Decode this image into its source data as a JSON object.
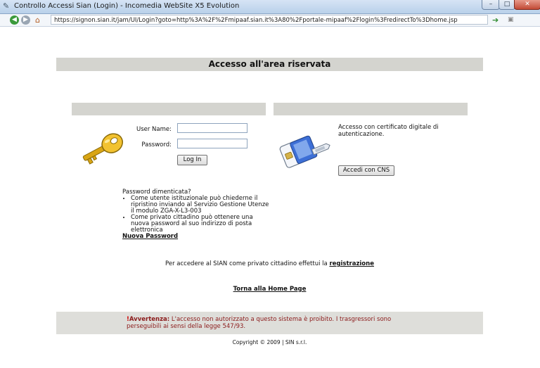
{
  "window": {
    "title": "Controllo Accessi Sian (Login) - Incomedia WebSite X5 Evolution",
    "min_label": "–",
    "max_label": "□",
    "close_label": "✕"
  },
  "address": {
    "url": "https://signon.sian.it/jam/UI/Login?goto=http%3A%2F%2Fmipaaf.sian.it%3A80%2Fportale-mipaaf%2Flogin%3FredirectTo%3Dhome.jsp"
  },
  "page": {
    "header": "Accesso all'area riservata",
    "login": {
      "user_label": "User Name:",
      "password_label": "Password:",
      "user_value": "",
      "password_value": "",
      "button": "Log In"
    },
    "cert": {
      "text": "Accesso con certificato digitale di autenticazione.",
      "button": "Accedi con CNS"
    },
    "forgot": {
      "title": "Password dimenticata?",
      "item1": "Come utente istituzionale può chiederne il ripristino inviando al Servizio Gestione Utenze il modulo ZGA-X-L3-003",
      "item2": "Come privato cittadino può ottenere una nuova password al suo indirizzo di posta elettronica",
      "link": "Nuova Password"
    },
    "privato": {
      "text": "Per accedere al SIAN come privato cittadino effettui la ",
      "link": "registrazione"
    },
    "home_link": "Torna alla Home Page",
    "warning": {
      "label": "Avvertenza:",
      "text": " L'accesso non autorizzato a questo sistema è proibito. I trasgressori sono perseguibili ai sensi della legge 547/93."
    },
    "copyright": "Copyright © 2009 | SIN s.r.l."
  },
  "colors": {
    "header_bg": "#d4d4cf",
    "warning_text": "#8b1a1a",
    "warning_bg": "#dededa"
  }
}
